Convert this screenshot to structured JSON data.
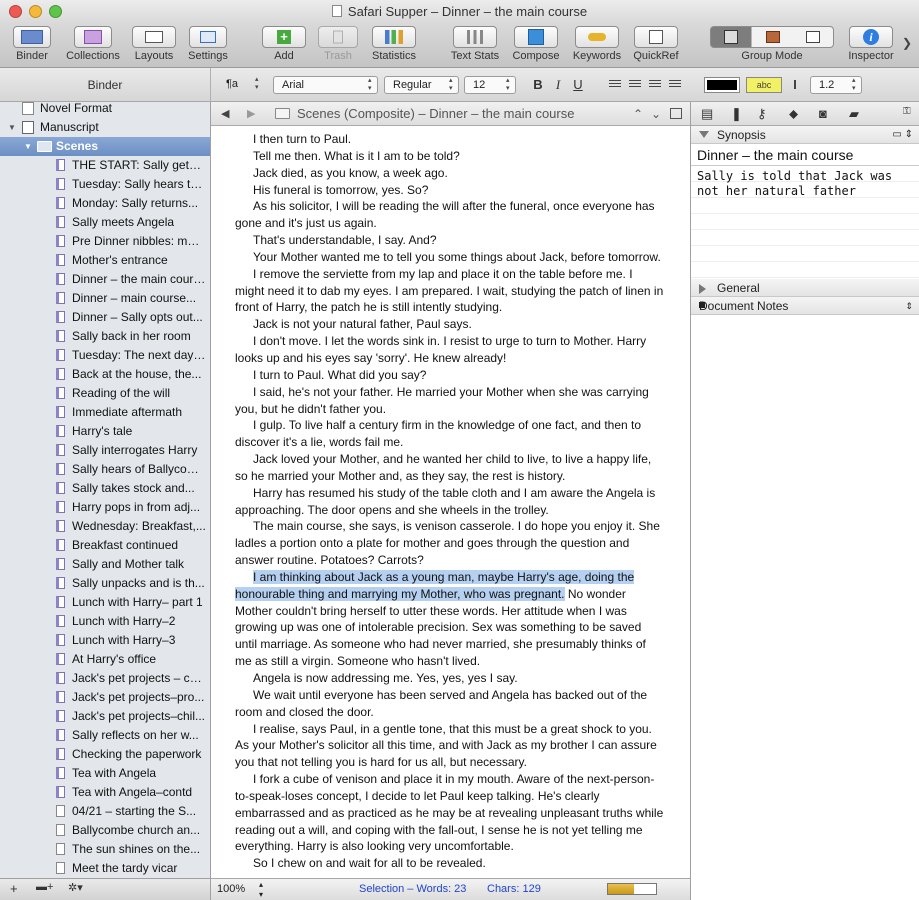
{
  "window": {
    "title": "Safari Supper – Dinner – the main course"
  },
  "toolbar": [
    {
      "label": "Binder",
      "icon": "binder-icon"
    },
    {
      "label": "Collections",
      "icon": "collections-icon"
    },
    {
      "label": "Layouts",
      "icon": "layouts-icon"
    },
    {
      "label": "Settings",
      "icon": "settings-icon"
    },
    {
      "label": "Add",
      "icon": "add-icon"
    },
    {
      "label": "Trash",
      "icon": "trash-icon"
    },
    {
      "label": "Statistics",
      "icon": "statistics-icon"
    },
    {
      "label": "Text Stats",
      "icon": "text-stats-icon"
    },
    {
      "label": "Compose",
      "icon": "compose-icon"
    },
    {
      "label": "Keywords",
      "icon": "keywords-icon"
    },
    {
      "label": "QuickRef",
      "icon": "quickref-icon"
    },
    {
      "label": "Group Mode",
      "icon": "group-mode-icon"
    },
    {
      "label": "Inspector",
      "icon": "inspector-icon"
    }
  ],
  "formatbar": {
    "binder_label": "Binder",
    "paragraph_style": "¶a",
    "font": "Arial",
    "weight": "Regular",
    "size": "12",
    "bold": "B",
    "italic": "I",
    "underline": "U",
    "highlight": "abc",
    "line_spacing": "1.2"
  },
  "binder": {
    "items": [
      {
        "label": "Novel Format",
        "kind": "root"
      },
      {
        "label": "Manuscript",
        "kind": "folder"
      },
      {
        "label": "Scenes",
        "kind": "folder-selected"
      },
      {
        "label": "THE START: Sally gets the...",
        "kind": "doc"
      },
      {
        "label": "Tuesday: Sally hears that...",
        "kind": "doc"
      },
      {
        "label": "Monday: Sally returns...",
        "kind": "doc"
      },
      {
        "label": "Sally meets Angela",
        "kind": "doc"
      },
      {
        "label": "Pre Dinner nibbles: meet...",
        "kind": "doc"
      },
      {
        "label": "Mother's entrance",
        "kind": "doc"
      },
      {
        "label": "Dinner – the main course",
        "kind": "doc"
      },
      {
        "label": "Dinner – main course...",
        "kind": "doc"
      },
      {
        "label": "Dinner – Sally opts out...",
        "kind": "doc"
      },
      {
        "label": "Sally back in her room",
        "kind": "doc"
      },
      {
        "label": "Tuesday: The next day:...",
        "kind": "doc"
      },
      {
        "label": "Back at the house, the...",
        "kind": "doc"
      },
      {
        "label": "Reading of the will",
        "kind": "doc"
      },
      {
        "label": "Immediate aftermath",
        "kind": "doc"
      },
      {
        "label": "Harry's tale",
        "kind": "doc"
      },
      {
        "label": "Sally interrogates Harry",
        "kind": "doc"
      },
      {
        "label": "Sally hears of Ballycom...",
        "kind": "doc"
      },
      {
        "label": "Sally takes stock and...",
        "kind": "doc"
      },
      {
        "label": "Harry pops in from adj...",
        "kind": "doc"
      },
      {
        "label": "Wednesday: Breakfast,...",
        "kind": "doc"
      },
      {
        "label": "Breakfast continued",
        "kind": "doc"
      },
      {
        "label": "Sally and Mother talk",
        "kind": "doc"
      },
      {
        "label": "Sally unpacks and is th...",
        "kind": "doc"
      },
      {
        "label": "Lunch with Harry– part 1",
        "kind": "doc"
      },
      {
        "label": "Lunch with Harry–2",
        "kind": "doc"
      },
      {
        "label": "Lunch with Harry–3",
        "kind": "doc"
      },
      {
        "label": "At Harry's office",
        "kind": "doc"
      },
      {
        "label": "Jack's pet projects – co...",
        "kind": "doc"
      },
      {
        "label": "Jack's pet projects–pro...",
        "kind": "doc"
      },
      {
        "label": "Jack's pet projects–chil...",
        "kind": "doc"
      },
      {
        "label": "Sally reflects on her w...",
        "kind": "doc"
      },
      {
        "label": "Checking the paperwork",
        "kind": "doc"
      },
      {
        "label": "Tea with Angela",
        "kind": "doc"
      },
      {
        "label": "Tea with Angela–contd",
        "kind": "doc"
      },
      {
        "label": "04/21 – starting the S...",
        "kind": "plain"
      },
      {
        "label": "Ballycombe church an...",
        "kind": "plain"
      },
      {
        "label": "The sun shines on the...",
        "kind": "plain"
      },
      {
        "label": "Meet the tardy vicar",
        "kind": "plain"
      }
    ],
    "footer": {
      "add": "+",
      "folder": "▬+",
      "gear": "✲▾"
    }
  },
  "editor": {
    "header_title": "Scenes (Composite) – Dinner – the main course",
    "paragraphs": [
      "I then turn to Paul.",
      "Tell me then. What is it I am to be told?",
      "Jack died, as you know, a week ago.",
      "His funeral is tomorrow, yes. So?",
      "As his solicitor, I will be reading the will after the funeral, once everyone has gone and it's just us again.",
      "That's understandable, I say. And?",
      "Your Mother wanted me to tell you some things about Jack, before tomorrow.",
      "I remove the serviette from my lap and place it on the table before me. I might need it to dab my eyes. I am prepared. I wait, studying the patch of linen in front of Harry, the patch he is still intently studying.",
      "Jack is not your natural father, Paul says.",
      "I don't move. I let the words sink in. I resist to urge to turn to Mother. Harry looks up and his eyes say 'sorry'. He knew already!",
      "I turn to Paul. What did you say?",
      "I said, he's not your father. He married your Mother when she was carrying you, but he didn't father you.",
      "I gulp. To live half a century firm in the knowledge of one fact, and then to discover it's a lie, words fail me.",
      " Jack loved your Mother, and he wanted her child to live, to live a happy life, so he married your Mother and, as they say, the rest is history.",
      "Harry has resumed his study of the table cloth and I am aware the Angela is approaching. The door opens and she wheels in the trolley.",
      "The main course, she says, is venison casserole. I do hope you enjoy it. She ladles a portion onto a plate for mother and goes through the question and answer routine. Potatoes? Carrots?",
      "HIGHLIGHT",
      "Angela is now addressing me. Yes, yes, yes I say.",
      "We wait until everyone has been served and Angela has backed out of the room and closed the door.",
      "I realise, says Paul, in a gentle tone, that this must be a great shock to you. As your Mother's solicitor all this time, and with Jack as my brother I can assure you that not telling you is hard for us all, but necessary.",
      "I fork a cube of venison and place it in my mouth. Aware of the next-person-to-speak-loses concept, I decide to let Paul keep talking. He's clearly embarrassed and as practiced as he may be at revealing unpleasant truths while reading out a will, and coping with the fall-out, I sense he is not yet telling me everything. Harry is also looking very uncomfortable.",
      "So I chew on and wait for all to be revealed."
    ],
    "highlight_selected": "I am thinking about Jack as a young man, maybe Harry's age, doing the honourable thing and marrying my Mother, who was pregnant.",
    "highlight_rest": " No wonder Mother couldn't bring herself to utter these words. Her attitude when I was growing up was one of intolerable precision. Sex was something to be saved until marriage. As someone who had never married, she presumably thinks of me as still a virgin. Someone who hasn't lived.",
    "footer": {
      "zoom": "100%",
      "selection": "Selection – Words: 23",
      "chars": "Chars: 129",
      "progress": 0.55
    }
  },
  "inspector": {
    "synopsis_label": "Synopsis",
    "synopsis_title": "Dinner – the main course",
    "synopsis_text": "Sally is told that Jack was not her natural father",
    "general_label": "General",
    "notes_label": "Document Notes"
  }
}
